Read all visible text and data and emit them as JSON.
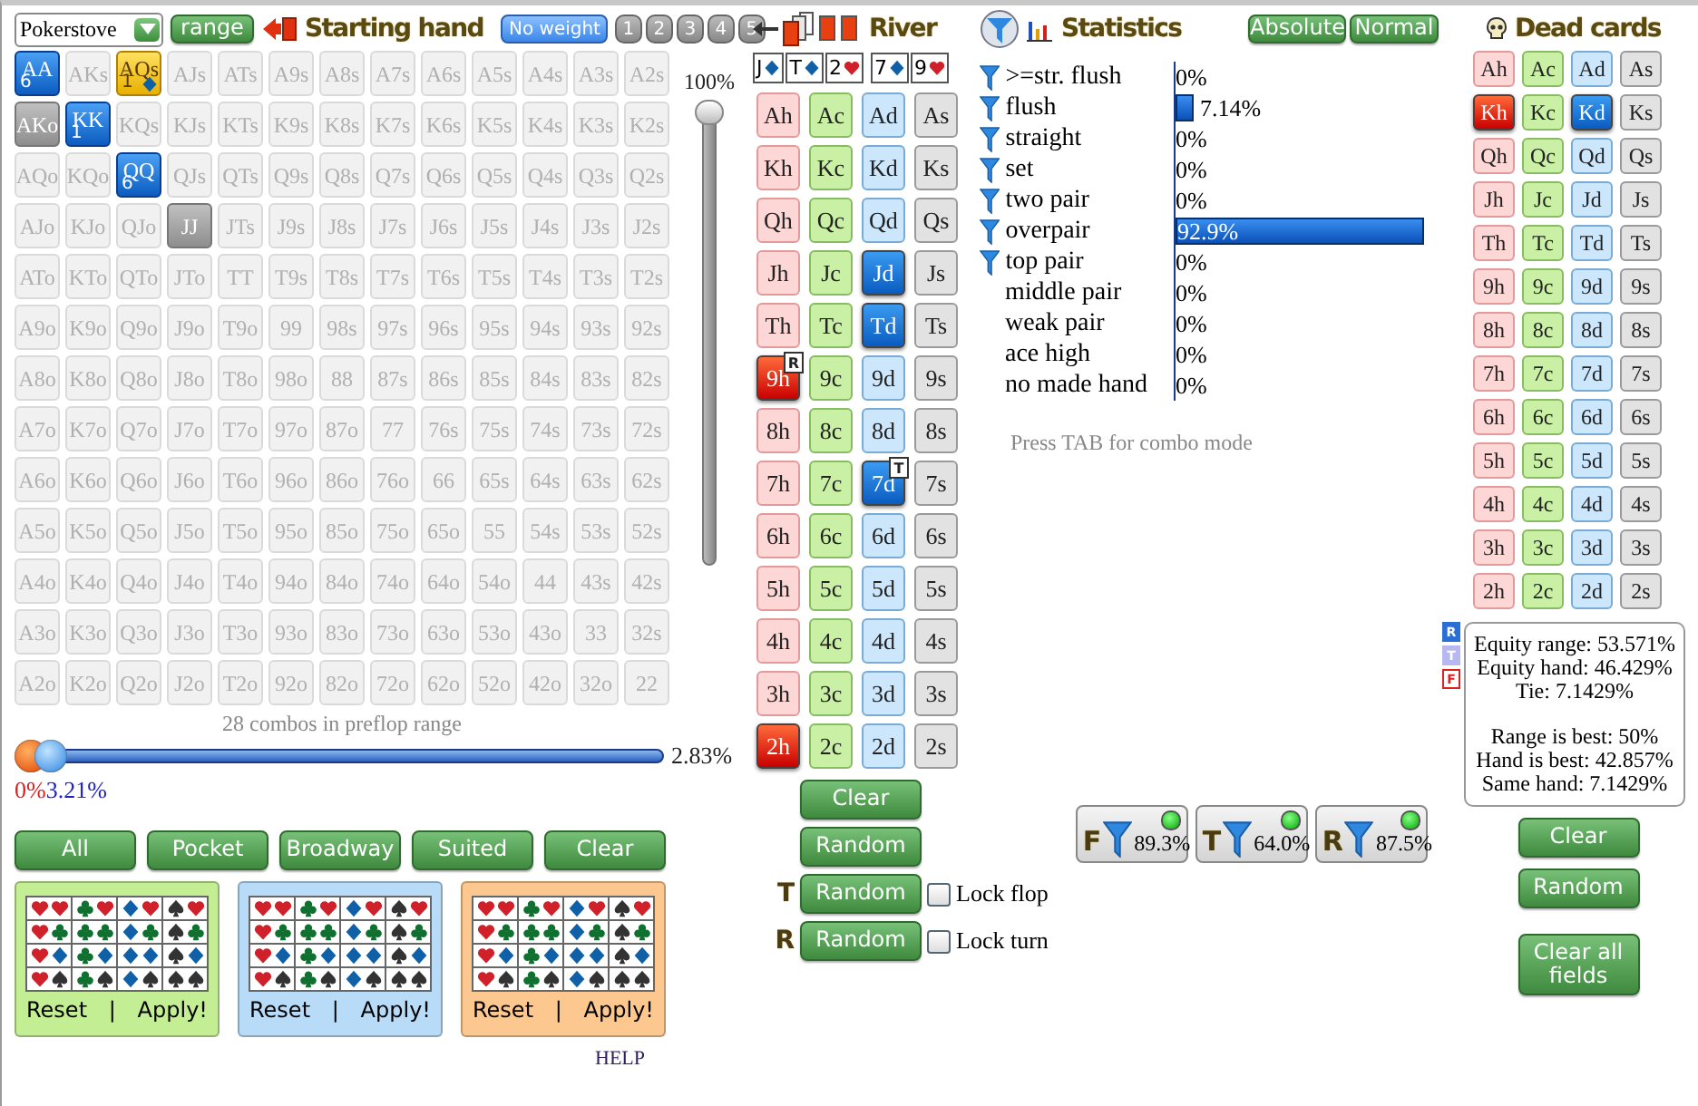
{
  "header": {
    "preset": "Pokerstove",
    "range_button": "range",
    "title": "Starting hand",
    "no_weight": "No weight",
    "weights": [
      "1",
      "2",
      "3",
      "4",
      "5"
    ]
  },
  "hand_grid": {
    "rows": [
      [
        {
          "label": "AA",
          "selected": true,
          "partial": false,
          "dead": false,
          "count": "6"
        },
        {
          "label": "AKs",
          "selected": false,
          "partial": false,
          "dead": false
        },
        {
          "label": "AQs",
          "selected": true,
          "partial": true,
          "dead": false,
          "count": "1"
        },
        {
          "label": "AJs",
          "selected": false,
          "partial": false,
          "dead": false
        },
        {
          "label": "ATs",
          "selected": false,
          "partial": false,
          "dead": false
        },
        {
          "label": "A9s",
          "selected": false,
          "partial": false,
          "dead": false
        },
        {
          "label": "A8s",
          "selected": false,
          "partial": false,
          "dead": false
        },
        {
          "label": "A7s",
          "selected": false,
          "partial": false,
          "dead": false
        },
        {
          "label": "A6s",
          "selected": false,
          "partial": false,
          "dead": false
        },
        {
          "label": "A5s",
          "selected": false,
          "partial": false,
          "dead": false
        },
        {
          "label": "A4s",
          "selected": false,
          "partial": false,
          "dead": false
        },
        {
          "label": "A3s",
          "selected": false,
          "partial": false,
          "dead": false
        },
        {
          "label": "A2s",
          "selected": false,
          "partial": false,
          "dead": false
        }
      ],
      [
        {
          "label": "AKo",
          "selected": false,
          "partial": false,
          "dead": true
        },
        {
          "label": "KK",
          "selected": true,
          "partial": false,
          "dead": false,
          "count": "1"
        },
        {
          "label": "KQs",
          "selected": false,
          "partial": false,
          "dead": false
        },
        {
          "label": "KJs",
          "selected": false,
          "partial": false,
          "dead": false
        },
        {
          "label": "KTs",
          "selected": false,
          "partial": false,
          "dead": false
        },
        {
          "label": "K9s",
          "selected": false,
          "partial": false,
          "dead": false
        },
        {
          "label": "K8s",
          "selected": false,
          "partial": false,
          "dead": false
        },
        {
          "label": "K7s",
          "selected": false,
          "partial": false,
          "dead": false
        },
        {
          "label": "K6s",
          "selected": false,
          "partial": false,
          "dead": false
        },
        {
          "label": "K5s",
          "selected": false,
          "partial": false,
          "dead": false
        },
        {
          "label": "K4s",
          "selected": false,
          "partial": false,
          "dead": false
        },
        {
          "label": "K3s",
          "selected": false,
          "partial": false,
          "dead": false
        },
        {
          "label": "K2s",
          "selected": false,
          "partial": false,
          "dead": false
        }
      ],
      [
        {
          "label": "AQo",
          "selected": false,
          "partial": false,
          "dead": false
        },
        {
          "label": "KQo",
          "selected": false,
          "partial": false,
          "dead": false
        },
        {
          "label": "QQ",
          "selected": true,
          "partial": false,
          "dead": false,
          "count": "6"
        },
        {
          "label": "QJs",
          "selected": false,
          "partial": false,
          "dead": false
        },
        {
          "label": "QTs",
          "selected": false,
          "partial": false,
          "dead": false
        },
        {
          "label": "Q9s",
          "selected": false,
          "partial": false,
          "dead": false
        },
        {
          "label": "Q8s",
          "selected": false,
          "partial": false,
          "dead": false
        },
        {
          "label": "Q7s",
          "selected": false,
          "partial": false,
          "dead": false
        },
        {
          "label": "Q6s",
          "selected": false,
          "partial": false,
          "dead": false
        },
        {
          "label": "Q5s",
          "selected": false,
          "partial": false,
          "dead": false
        },
        {
          "label": "Q4s",
          "selected": false,
          "partial": false,
          "dead": false
        },
        {
          "label": "Q3s",
          "selected": false,
          "partial": false,
          "dead": false
        },
        {
          "label": "Q2s",
          "selected": false,
          "partial": false,
          "dead": false
        }
      ],
      [
        {
          "label": "AJo",
          "selected": false,
          "partial": false,
          "dead": false
        },
        {
          "label": "KJo",
          "selected": false,
          "partial": false,
          "dead": false
        },
        {
          "label": "QJo",
          "selected": false,
          "partial": false,
          "dead": false
        },
        {
          "label": "JJ",
          "selected": false,
          "partial": false,
          "dead": true
        },
        {
          "label": "JTs",
          "selected": false,
          "partial": false,
          "dead": false
        },
        {
          "label": "J9s",
          "selected": false,
          "partial": false,
          "dead": false
        },
        {
          "label": "J8s",
          "selected": false,
          "partial": false,
          "dead": false
        },
        {
          "label": "J7s",
          "selected": false,
          "partial": false,
          "dead": false
        },
        {
          "label": "J6s",
          "selected": false,
          "partial": false,
          "dead": false
        },
        {
          "label": "J5s",
          "selected": false,
          "partial": false,
          "dead": false
        },
        {
          "label": "J4s",
          "selected": false,
          "partial": false,
          "dead": false
        },
        {
          "label": "J3s",
          "selected": false,
          "partial": false,
          "dead": false
        },
        {
          "label": "J2s",
          "selected": false,
          "partial": false,
          "dead": false
        }
      ],
      [
        {
          "label": "ATo",
          "selected": false,
          "partial": false,
          "dead": false
        },
        {
          "label": "KTo",
          "selected": false,
          "partial": false,
          "dead": false
        },
        {
          "label": "QTo",
          "selected": false,
          "partial": false,
          "dead": false
        },
        {
          "label": "JTo",
          "selected": false,
          "partial": false,
          "dead": false
        },
        {
          "label": "TT",
          "selected": false,
          "partial": false,
          "dead": false
        },
        {
          "label": "T9s",
          "selected": false,
          "partial": false,
          "dead": false
        },
        {
          "label": "T8s",
          "selected": false,
          "partial": false,
          "dead": false
        },
        {
          "label": "T7s",
          "selected": false,
          "partial": false,
          "dead": false
        },
        {
          "label": "T6s",
          "selected": false,
          "partial": false,
          "dead": false
        },
        {
          "label": "T5s",
          "selected": false,
          "partial": false,
          "dead": false
        },
        {
          "label": "T4s",
          "selected": false,
          "partial": false,
          "dead": false
        },
        {
          "label": "T3s",
          "selected": false,
          "partial": false,
          "dead": false
        },
        {
          "label": "T2s",
          "selected": false,
          "partial": false,
          "dead": false
        }
      ],
      [
        {
          "label": "A9o",
          "selected": false,
          "partial": false,
          "dead": false
        },
        {
          "label": "K9o",
          "selected": false,
          "partial": false,
          "dead": false
        },
        {
          "label": "Q9o",
          "selected": false,
          "partial": false,
          "dead": false
        },
        {
          "label": "J9o",
          "selected": false,
          "partial": false,
          "dead": false
        },
        {
          "label": "T9o",
          "selected": false,
          "partial": false,
          "dead": false
        },
        {
          "label": "99",
          "selected": false,
          "partial": false,
          "dead": false
        },
        {
          "label": "98s",
          "selected": false,
          "partial": false,
          "dead": false
        },
        {
          "label": "97s",
          "selected": false,
          "partial": false,
          "dead": false
        },
        {
          "label": "96s",
          "selected": false,
          "partial": false,
          "dead": false
        },
        {
          "label": "95s",
          "selected": false,
          "partial": false,
          "dead": false
        },
        {
          "label": "94s",
          "selected": false,
          "partial": false,
          "dead": false
        },
        {
          "label": "93s",
          "selected": false,
          "partial": false,
          "dead": false
        },
        {
          "label": "92s",
          "selected": false,
          "partial": false,
          "dead": false
        }
      ],
      [
        {
          "label": "A8o",
          "selected": false,
          "partial": false,
          "dead": false
        },
        {
          "label": "K8o",
          "selected": false,
          "partial": false,
          "dead": false
        },
        {
          "label": "Q8o",
          "selected": false,
          "partial": false,
          "dead": false
        },
        {
          "label": "J8o",
          "selected": false,
          "partial": false,
          "dead": false
        },
        {
          "label": "T8o",
          "selected": false,
          "partial": false,
          "dead": false
        },
        {
          "label": "98o",
          "selected": false,
          "partial": false,
          "dead": false
        },
        {
          "label": "88",
          "selected": false,
          "partial": false,
          "dead": false
        },
        {
          "label": "87s",
          "selected": false,
          "partial": false,
          "dead": false
        },
        {
          "label": "86s",
          "selected": false,
          "partial": false,
          "dead": false
        },
        {
          "label": "85s",
          "selected": false,
          "partial": false,
          "dead": false
        },
        {
          "label": "84s",
          "selected": false,
          "partial": false,
          "dead": false
        },
        {
          "label": "83s",
          "selected": false,
          "partial": false,
          "dead": false
        },
        {
          "label": "82s",
          "selected": false,
          "partial": false,
          "dead": false
        }
      ],
      [
        {
          "label": "A7o",
          "selected": false,
          "partial": false,
          "dead": false
        },
        {
          "label": "K7o",
          "selected": false,
          "partial": false,
          "dead": false
        },
        {
          "label": "Q7o",
          "selected": false,
          "partial": false,
          "dead": false
        },
        {
          "label": "J7o",
          "selected": false,
          "partial": false,
          "dead": false
        },
        {
          "label": "T7o",
          "selected": false,
          "partial": false,
          "dead": false
        },
        {
          "label": "97o",
          "selected": false,
          "partial": false,
          "dead": false
        },
        {
          "label": "87o",
          "selected": false,
          "partial": false,
          "dead": false
        },
        {
          "label": "77",
          "selected": false,
          "partial": false,
          "dead": false
        },
        {
          "label": "76s",
          "selected": false,
          "partial": false,
          "dead": false
        },
        {
          "label": "75s",
          "selected": false,
          "partial": false,
          "dead": false
        },
        {
          "label": "74s",
          "selected": false,
          "partial": false,
          "dead": false
        },
        {
          "label": "73s",
          "selected": false,
          "partial": false,
          "dead": false
        },
        {
          "label": "72s",
          "selected": false,
          "partial": false,
          "dead": false
        }
      ],
      [
        {
          "label": "A6o",
          "selected": false,
          "partial": false,
          "dead": false
        },
        {
          "label": "K6o",
          "selected": false,
          "partial": false,
          "dead": false
        },
        {
          "label": "Q6o",
          "selected": false,
          "partial": false,
          "dead": false
        },
        {
          "label": "J6o",
          "selected": false,
          "partial": false,
          "dead": false
        },
        {
          "label": "T6o",
          "selected": false,
          "partial": false,
          "dead": false
        },
        {
          "label": "96o",
          "selected": false,
          "partial": false,
          "dead": false
        },
        {
          "label": "86o",
          "selected": false,
          "partial": false,
          "dead": false
        },
        {
          "label": "76o",
          "selected": false,
          "partial": false,
          "dead": false
        },
        {
          "label": "66",
          "selected": false,
          "partial": false,
          "dead": false
        },
        {
          "label": "65s",
          "selected": false,
          "partial": false,
          "dead": false
        },
        {
          "label": "64s",
          "selected": false,
          "partial": false,
          "dead": false
        },
        {
          "label": "63s",
          "selected": false,
          "partial": false,
          "dead": false
        },
        {
          "label": "62s",
          "selected": false,
          "partial": false,
          "dead": false
        }
      ],
      [
        {
          "label": "A5o",
          "selected": false,
          "partial": false,
          "dead": false
        },
        {
          "label": "K5o",
          "selected": false,
          "partial": false,
          "dead": false
        },
        {
          "label": "Q5o",
          "selected": false,
          "partial": false,
          "dead": false
        },
        {
          "label": "J5o",
          "selected": false,
          "partial": false,
          "dead": false
        },
        {
          "label": "T5o",
          "selected": false,
          "partial": false,
          "dead": false
        },
        {
          "label": "95o",
          "selected": false,
          "partial": false,
          "dead": false
        },
        {
          "label": "85o",
          "selected": false,
          "partial": false,
          "dead": false
        },
        {
          "label": "75o",
          "selected": false,
          "partial": false,
          "dead": false
        },
        {
          "label": "65o",
          "selected": false,
          "partial": false,
          "dead": false
        },
        {
          "label": "55",
          "selected": false,
          "partial": false,
          "dead": false
        },
        {
          "label": "54s",
          "selected": false,
          "partial": false,
          "dead": false
        },
        {
          "label": "53s",
          "selected": false,
          "partial": false,
          "dead": false
        },
        {
          "label": "52s",
          "selected": false,
          "partial": false,
          "dead": false
        }
      ],
      [
        {
          "label": "A4o",
          "selected": false,
          "partial": false,
          "dead": false
        },
        {
          "label": "K4o",
          "selected": false,
          "partial": false,
          "dead": false
        },
        {
          "label": "Q4o",
          "selected": false,
          "partial": false,
          "dead": false
        },
        {
          "label": "J4o",
          "selected": false,
          "partial": false,
          "dead": false
        },
        {
          "label": "T4o",
          "selected": false,
          "partial": false,
          "dead": false
        },
        {
          "label": "94o",
          "selected": false,
          "partial": false,
          "dead": false
        },
        {
          "label": "84o",
          "selected": false,
          "partial": false,
          "dead": false
        },
        {
          "label": "74o",
          "selected": false,
          "partial": false,
          "dead": false
        },
        {
          "label": "64o",
          "selected": false,
          "partial": false,
          "dead": false
        },
        {
          "label": "54o",
          "selected": false,
          "partial": false,
          "dead": false
        },
        {
          "label": "44",
          "selected": false,
          "partial": false,
          "dead": false
        },
        {
          "label": "43s",
          "selected": false,
          "partial": false,
          "dead": false
        },
        {
          "label": "42s",
          "selected": false,
          "partial": false,
          "dead": false
        }
      ],
      [
        {
          "label": "A3o",
          "selected": false,
          "partial": false,
          "dead": false
        },
        {
          "label": "K3o",
          "selected": false,
          "partial": false,
          "dead": false
        },
        {
          "label": "Q3o",
          "selected": false,
          "partial": false,
          "dead": false
        },
        {
          "label": "J3o",
          "selected": false,
          "partial": false,
          "dead": false
        },
        {
          "label": "T3o",
          "selected": false,
          "partial": false,
          "dead": false
        },
        {
          "label": "93o",
          "selected": false,
          "partial": false,
          "dead": false
        },
        {
          "label": "83o",
          "selected": false,
          "partial": false,
          "dead": false
        },
        {
          "label": "73o",
          "selected": false,
          "partial": false,
          "dead": false
        },
        {
          "label": "63o",
          "selected": false,
          "partial": false,
          "dead": false
        },
        {
          "label": "53o",
          "selected": false,
          "partial": false,
          "dead": false
        },
        {
          "label": "43o",
          "selected": false,
          "partial": false,
          "dead": false
        },
        {
          "label": "33",
          "selected": false,
          "partial": false,
          "dead": false
        },
        {
          "label": "32s",
          "selected": false,
          "partial": false,
          "dead": false
        }
      ],
      [
        {
          "label": "A2o",
          "selected": false,
          "partial": false,
          "dead": false
        },
        {
          "label": "K2o",
          "selected": false,
          "partial": false,
          "dead": false
        },
        {
          "label": "Q2o",
          "selected": false,
          "partial": false,
          "dead": false
        },
        {
          "label": "J2o",
          "selected": false,
          "partial": false,
          "dead": false
        },
        {
          "label": "T2o",
          "selected": false,
          "partial": false,
          "dead": false
        },
        {
          "label": "92o",
          "selected": false,
          "partial": false,
          "dead": false
        },
        {
          "label": "82o",
          "selected": false,
          "partial": false,
          "dead": false
        },
        {
          "label": "72o",
          "selected": false,
          "partial": false,
          "dead": false
        },
        {
          "label": "62o",
          "selected": false,
          "partial": false,
          "dead": false
        },
        {
          "label": "52o",
          "selected": false,
          "partial": false,
          "dead": false
        },
        {
          "label": "42o",
          "selected": false,
          "partial": false,
          "dead": false
        },
        {
          "label": "32o",
          "selected": false,
          "partial": false,
          "dead": false
        },
        {
          "label": "22",
          "selected": false,
          "partial": false,
          "dead": false
        }
      ]
    ]
  },
  "weight_slider": {
    "label": "100%",
    "level": 1
  },
  "combos_text": "28 combos in preflop range",
  "range_slider": {
    "level": 0.03,
    "value": "2.83%",
    "low": "0%",
    "high": "3.21%"
  },
  "quick_buttons": [
    "All",
    "Pocket",
    "Broadway",
    "Suited",
    "Clear"
  ],
  "suit_order": [
    {
      "kind": "heart"
    },
    {
      "kind": "club"
    },
    {
      "kind": "diamond"
    },
    {
      "kind": "spade"
    }
  ],
  "suit_panels": [
    {
      "color": "#c4ee94",
      "reset": "Reset",
      "separator": "|",
      "apply": "Apply!"
    },
    {
      "color": "#b8dcf8",
      "reset": "Reset",
      "separator": "|",
      "apply": "Apply!"
    },
    {
      "color": "#fcc890",
      "reset": "Reset",
      "separator": "|",
      "apply": "Apply!"
    }
  ],
  "help": "HELP",
  "board": {
    "title": "River",
    "cards": [
      {
        "rank": "J",
        "kind": "diamond"
      },
      {
        "rank": "T",
        "kind": "diamond"
      },
      {
        "rank": "2",
        "kind": "heart"
      },
      {
        "rank": "7",
        "kind": "diamond"
      },
      {
        "rank": "9",
        "kind": "heart"
      }
    ]
  },
  "card_grid": {
    "columns": [
      {
        "kind": "heart"
      },
      {
        "kind": "club"
      },
      {
        "kind": "diamond"
      },
      {
        "kind": "spade"
      }
    ],
    "rows": [
      [
        {
          "label": "Ah",
          "selected": false
        },
        {
          "label": "Ac",
          "selected": false
        },
        {
          "label": "Ad",
          "selected": false
        },
        {
          "label": "As",
          "selected": false
        }
      ],
      [
        {
          "label": "Kh",
          "selected": false
        },
        {
          "label": "Kc",
          "selected": false
        },
        {
          "label": "Kd",
          "selected": false
        },
        {
          "label": "Ks",
          "selected": false
        }
      ],
      [
        {
          "label": "Qh",
          "selected": false
        },
        {
          "label": "Qc",
          "selected": false
        },
        {
          "label": "Qd",
          "selected": false
        },
        {
          "label": "Qs",
          "selected": false
        }
      ],
      [
        {
          "label": "Jh",
          "selected": false
        },
        {
          "label": "Jc",
          "selected": false
        },
        {
          "label": "Jd",
          "selected": true
        },
        {
          "label": "Js",
          "selected": false
        }
      ],
      [
        {
          "label": "Th",
          "selected": false
        },
        {
          "label": "Tc",
          "selected": false
        },
        {
          "label": "Td",
          "selected": true
        },
        {
          "label": "Ts",
          "selected": false
        }
      ],
      [
        {
          "label": "9h",
          "selected": true,
          "badge": "R"
        },
        {
          "label": "9c",
          "selected": false
        },
        {
          "label": "9d",
          "selected": false
        },
        {
          "label": "9s",
          "selected": false
        }
      ],
      [
        {
          "label": "8h",
          "selected": false
        },
        {
          "label": "8c",
          "selected": false
        },
        {
          "label": "8d",
          "selected": false
        },
        {
          "label": "8s",
          "selected": false
        }
      ],
      [
        {
          "label": "7h",
          "selected": false
        },
        {
          "label": "7c",
          "selected": false
        },
        {
          "label": "7d",
          "selected": true,
          "badge": "T"
        },
        {
          "label": "7s",
          "selected": false
        }
      ],
      [
        {
          "label": "6h",
          "selected": false
        },
        {
          "label": "6c",
          "selected": false
        },
        {
          "label": "6d",
          "selected": false
        },
        {
          "label": "6s",
          "selected": false
        }
      ],
      [
        {
          "label": "5h",
          "selected": false
        },
        {
          "label": "5c",
          "selected": false
        },
        {
          "label": "5d",
          "selected": false
        },
        {
          "label": "5s",
          "selected": false
        }
      ],
      [
        {
          "label": "4h",
          "selected": false
        },
        {
          "label": "4c",
          "selected": false
        },
        {
          "label": "4d",
          "selected": false
        },
        {
          "label": "4s",
          "selected": false
        }
      ],
      [
        {
          "label": "3h",
          "selected": false
        },
        {
          "label": "3c",
          "selected": false
        },
        {
          "label": "3d",
          "selected": false
        },
        {
          "label": "3s",
          "selected": false
        }
      ],
      [
        {
          "label": "2h",
          "selected": true
        },
        {
          "label": "2c",
          "selected": false
        },
        {
          "label": "2d",
          "selected": false
        },
        {
          "label": "2s",
          "selected": false
        }
      ]
    ]
  },
  "board_buttons": {
    "clear": "Clear",
    "random": "Random",
    "turn_letter": "T",
    "turn_random": "Random",
    "lock_flop": {
      "label": "Lock flop",
      "checked": false
    },
    "river_letter": "R",
    "river_random": "Random",
    "lock_turn": {
      "label": "Lock turn",
      "checked": false
    }
  },
  "statistics": {
    "title": "Statistics",
    "modes": [
      "Absolute",
      "Normal"
    ],
    "hint": "Press TAB for combo mode",
    "rows": [
      {
        "label": ">=str. flush",
        "value": "0%",
        "filter": true
      },
      {
        "label": "flush",
        "value": "7.14%",
        "level": 0.0714,
        "filter": true
      },
      {
        "label": "straight",
        "value": "0%",
        "filter": true
      },
      {
        "label": "set",
        "value": "0%",
        "filter": true
      },
      {
        "label": "two pair",
        "value": "0%",
        "filter": true
      },
      {
        "label": "overpair",
        "value": "92.9%",
        "level": 0.929,
        "filter": true
      },
      {
        "label": "top pair",
        "value": "0%",
        "filter": true
      },
      {
        "label": "middle pair",
        "value": "0%",
        "filter": false
      },
      {
        "label": "weak pair",
        "value": "0%",
        "filter": false
      },
      {
        "label": "ace high",
        "value": "0%",
        "filter": false
      },
      {
        "label": "no made hand",
        "value": "0%",
        "filter": false
      }
    ]
  },
  "filters": [
    {
      "letter": "F",
      "value": "89.3%",
      "active": true
    },
    {
      "letter": "T",
      "value": "64.0%",
      "active": true
    },
    {
      "letter": "R",
      "value": "87.5%",
      "active": true
    }
  ],
  "dead_cards": {
    "title": "Dead cards",
    "rows": [
      [
        {
          "label": "Ah",
          "selected": false
        },
        {
          "label": "Ac",
          "selected": false
        },
        {
          "label": "Ad",
          "selected": false
        },
        {
          "label": "As",
          "selected": false
        }
      ],
      [
        {
          "label": "Kh",
          "selected": true
        },
        {
          "label": "Kc",
          "selected": false
        },
        {
          "label": "Kd",
          "selected": true
        },
        {
          "label": "Ks",
          "selected": false
        }
      ],
      [
        {
          "label": "Qh",
          "selected": false
        },
        {
          "label": "Qc",
          "selected": false
        },
        {
          "label": "Qd",
          "selected": false
        },
        {
          "label": "Qs",
          "selected": false
        }
      ],
      [
        {
          "label": "Jh",
          "selected": false
        },
        {
          "label": "Jc",
          "selected": false
        },
        {
          "label": "Jd",
          "selected": false
        },
        {
          "label": "Js",
          "selected": false
        }
      ],
      [
        {
          "label": "Th",
          "selected": false
        },
        {
          "label": "Tc",
          "selected": false
        },
        {
          "label": "Td",
          "selected": false
        },
        {
          "label": "Ts",
          "selected": false
        }
      ],
      [
        {
          "label": "9h",
          "selected": false
        },
        {
          "label": "9c",
          "selected": false
        },
        {
          "label": "9d",
          "selected": false
        },
        {
          "label": "9s",
          "selected": false
        }
      ],
      [
        {
          "label": "8h",
          "selected": false
        },
        {
          "label": "8c",
          "selected": false
        },
        {
          "label": "8d",
          "selected": false
        },
        {
          "label": "8s",
          "selected": false
        }
      ],
      [
        {
          "label": "7h",
          "selected": false
        },
        {
          "label": "7c",
          "selected": false
        },
        {
          "label": "7d",
          "selected": false
        },
        {
          "label": "7s",
          "selected": false
        }
      ],
      [
        {
          "label": "6h",
          "selected": false
        },
        {
          "label": "6c",
          "selected": false
        },
        {
          "label": "6d",
          "selected": false
        },
        {
          "label": "6s",
          "selected": false
        }
      ],
      [
        {
          "label": "5h",
          "selected": false
        },
        {
          "label": "5c",
          "selected": false
        },
        {
          "label": "5d",
          "selected": false
        },
        {
          "label": "5s",
          "selected": false
        }
      ],
      [
        {
          "label": "4h",
          "selected": false
        },
        {
          "label": "4c",
          "selected": false
        },
        {
          "label": "4d",
          "selected": false
        },
        {
          "label": "4s",
          "selected": false
        }
      ],
      [
        {
          "label": "3h",
          "selected": false
        },
        {
          "label": "3c",
          "selected": false
        },
        {
          "label": "3d",
          "selected": false
        },
        {
          "label": "3s",
          "selected": false
        }
      ],
      [
        {
          "label": "2h",
          "selected": false
        },
        {
          "label": "2c",
          "selected": false
        },
        {
          "label": "2d",
          "selected": false
        },
        {
          "label": "2s",
          "selected": false
        }
      ]
    ]
  },
  "street_markers": [
    {
      "letter": "R",
      "color": "#2a6fd6"
    },
    {
      "letter": "T",
      "color": "#b8b8f0"
    },
    {
      "letter": "F",
      "color": "#e02020"
    }
  ],
  "equity": {
    "lines": [
      "Equity range: 53.571%",
      "Equity hand: 46.429%",
      "Tie: 7.1429%"
    ],
    "outcomes": [
      "Range is best: 50%",
      "Hand is best: 42.857%",
      "Same hand: 7.1429%"
    ]
  },
  "dead_buttons": [
    "Clear",
    "Random",
    "Clear all fields"
  ]
}
